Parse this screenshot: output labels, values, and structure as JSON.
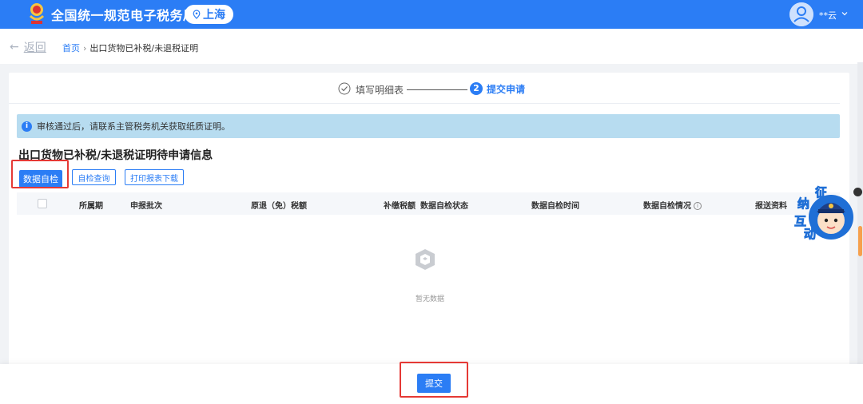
{
  "header": {
    "app_title": "全国统一规范电子税务局",
    "region": "上海",
    "username": "**云",
    "colors": {
      "brand": "#2b7df5",
      "highlight": "#e53935",
      "notice_bg": "#b7dcf0"
    },
    "icons": [
      "tax-emblem-icon",
      "location-pin-icon",
      "user-avatar-icon",
      "chevron-down-icon"
    ]
  },
  "breadcrumb": {
    "back_label": "返回",
    "home": "首页",
    "separator": "›",
    "current": "出口货物已补税/未退税证明"
  },
  "steps": [
    {
      "label": "填写明细表",
      "state": "done"
    },
    {
      "number": "2",
      "label": "提交申请",
      "state": "active"
    }
  ],
  "notice": {
    "icon_text": "i",
    "text": "审核通过后，请联系主管税务机关获取纸质证明。"
  },
  "section": {
    "title": "出口货物已补税/未退税证明待申请信息"
  },
  "toolbar": {
    "self_check_label": "数据自检",
    "self_check_query_label": "自检查询",
    "print_download_label": "打印报表下载"
  },
  "table": {
    "columns": {
      "period": "所属期",
      "batch": "申报批次",
      "refund_tax": "原退（免）税额",
      "supplement_tax": "补缴税额",
      "check_status": "数据自检状态",
      "check_time": "数据自检时间",
      "check_result": "数据自检情况",
      "submit_docs": "报送资料"
    },
    "rows": [],
    "empty_text": "暂无数据"
  },
  "mascot": {
    "chars": [
      "征",
      "纳",
      "互",
      "动"
    ]
  },
  "footer": {
    "submit_label": "提交"
  }
}
